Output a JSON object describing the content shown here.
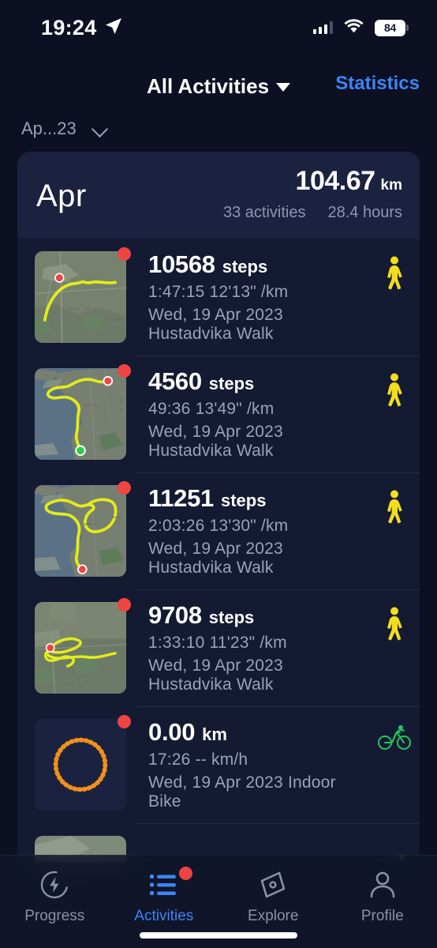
{
  "status_bar": {
    "time": "19:24",
    "location_icon": "location-arrow-icon",
    "signal_icon": "cellular-signal-icon",
    "wifi_icon": "wifi-icon",
    "battery_level": "84"
  },
  "nav": {
    "title": "All Activities",
    "dropdown_icon": "caret-down-icon",
    "right_action": "Statistics"
  },
  "month_selector": {
    "label": "Ap...23",
    "chevron_icon": "chevron-down-icon"
  },
  "summary": {
    "month": "Apr",
    "distance_value": "104.67",
    "distance_unit": "km",
    "activities": "33 activities",
    "hours": "28.4 hours"
  },
  "activities": [
    {
      "value": "10568",
      "unit": "steps",
      "duration": "1:47:15",
      "pace": "12'13\" /km",
      "meta": "1:47:15  12'13\" /km",
      "date_title": "Wed, 19 Apr 2023 Hustadvika Walk",
      "type_icon": "walking-person-icon",
      "type_color": "#f2dd1e",
      "map_kind": "terrain",
      "badge": true
    },
    {
      "value": "4560",
      "unit": "steps",
      "duration": "49:36",
      "pace": "13'49\" /km",
      "meta": "49:36  13'49\" /km",
      "date_title": "Wed, 19 Apr 2023 Hustadvika Walk",
      "type_icon": "walking-person-icon",
      "type_color": "#f2dd1e",
      "map_kind": "coastal",
      "badge": true
    },
    {
      "value": "11251",
      "unit": "steps",
      "duration": "2:03:26",
      "pace": "13'30\" /km",
      "meta": "2:03:26  13'30\" /km",
      "date_title": "Wed, 19 Apr 2023 Hustadvika Walk",
      "type_icon": "walking-person-icon",
      "type_color": "#f2dd1e",
      "map_kind": "coastal2",
      "badge": true
    },
    {
      "value": "9708",
      "unit": "steps",
      "duration": "1:33:10",
      "pace": "11'23\" /km",
      "meta": "1:33:10  11'23\" /km",
      "date_title": "Wed, 19 Apr 2023 Hustadvika Walk",
      "type_icon": "walking-person-icon",
      "type_color": "#f2dd1e",
      "map_kind": "terrain2",
      "badge": true
    },
    {
      "value": "0.00",
      "unit": "km",
      "duration": "17:26",
      "pace": "-- km/h",
      "meta": "17:26  -- km/h",
      "date_title": "Wed, 19 Apr 2023 Indoor Bike",
      "type_icon": "bicycle-icon",
      "type_color": "#22c55e",
      "map_kind": "indoor",
      "badge": true
    }
  ],
  "tabs": [
    {
      "label": "Progress",
      "icon": "progress-bolt-icon",
      "active": false,
      "badge": false
    },
    {
      "label": "Activities",
      "icon": "list-icon",
      "active": true,
      "badge": true
    },
    {
      "label": "Explore",
      "icon": "compass-icon",
      "active": false,
      "badge": false
    },
    {
      "label": "Profile",
      "icon": "person-icon",
      "active": false,
      "badge": false
    }
  ],
  "colors": {
    "background": "#0c1022",
    "card": "#141a31",
    "summary_card": "#1b2240",
    "accent_blue": "#3d84f5",
    "badge_red": "#ef4444",
    "route_yellow": "#e3ec19",
    "muted_text": "#9aa2b8"
  }
}
